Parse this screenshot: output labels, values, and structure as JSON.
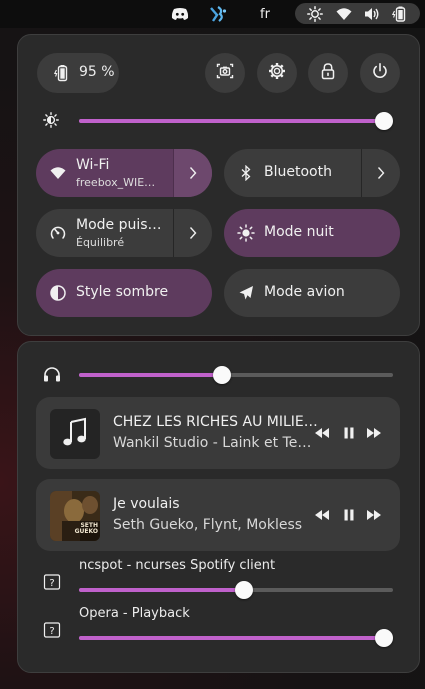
{
  "topbar": {
    "lang": "fr",
    "icons": [
      "discord-icon",
      "app-icon",
      "brightness-icon",
      "wifi-icon",
      "volume-icon",
      "battery-icon"
    ]
  },
  "quick_settings": {
    "battery_label": "95 %",
    "brightness_level": 1.0,
    "header_icons": [
      "screenshot-icon",
      "settings-icon",
      "lock-icon",
      "power-icon"
    ],
    "tiles": [
      {
        "title": "Wi-Fi",
        "subtitle": "freebox_WIE…",
        "active": true,
        "arrow": true,
        "icon": "wifi-icon"
      },
      {
        "title": "Bluetooth",
        "subtitle": "",
        "active": false,
        "arrow": true,
        "icon": "bluetooth-icon"
      },
      {
        "title": "Mode puis…",
        "subtitle": "Équilibré",
        "active": false,
        "arrow": true,
        "icon": "power-mode-icon"
      },
      {
        "title": "Mode nuit",
        "subtitle": "",
        "active": true,
        "arrow": false,
        "icon": "night-light-icon"
      },
      {
        "title": "Style sombre",
        "subtitle": "",
        "active": true,
        "arrow": false,
        "icon": "dark-style-icon"
      },
      {
        "title": "Mode avion",
        "subtitle": "",
        "active": false,
        "arrow": false,
        "icon": "airplane-icon"
      }
    ]
  },
  "media": {
    "output_volume": 0.47,
    "players": [
      {
        "title": "CHEZ LES RICHES AU MILIE…",
        "artist": "Wankil Studio - Laink et Te…"
      },
      {
        "title": "Je voulais",
        "artist": "Seth Gueko, Flynt, Mokless"
      }
    ],
    "apps": [
      {
        "name": "ncspot - ncurses Spotify client",
        "volume": 0.54
      },
      {
        "name": "Opera - Playback",
        "volume": 1.0
      }
    ]
  },
  "colors": {
    "accent": "#c061cb",
    "tile_active": "#5e3b5e",
    "tile_inactive": "#3c3c3c",
    "panel": "#2a2a2a"
  }
}
